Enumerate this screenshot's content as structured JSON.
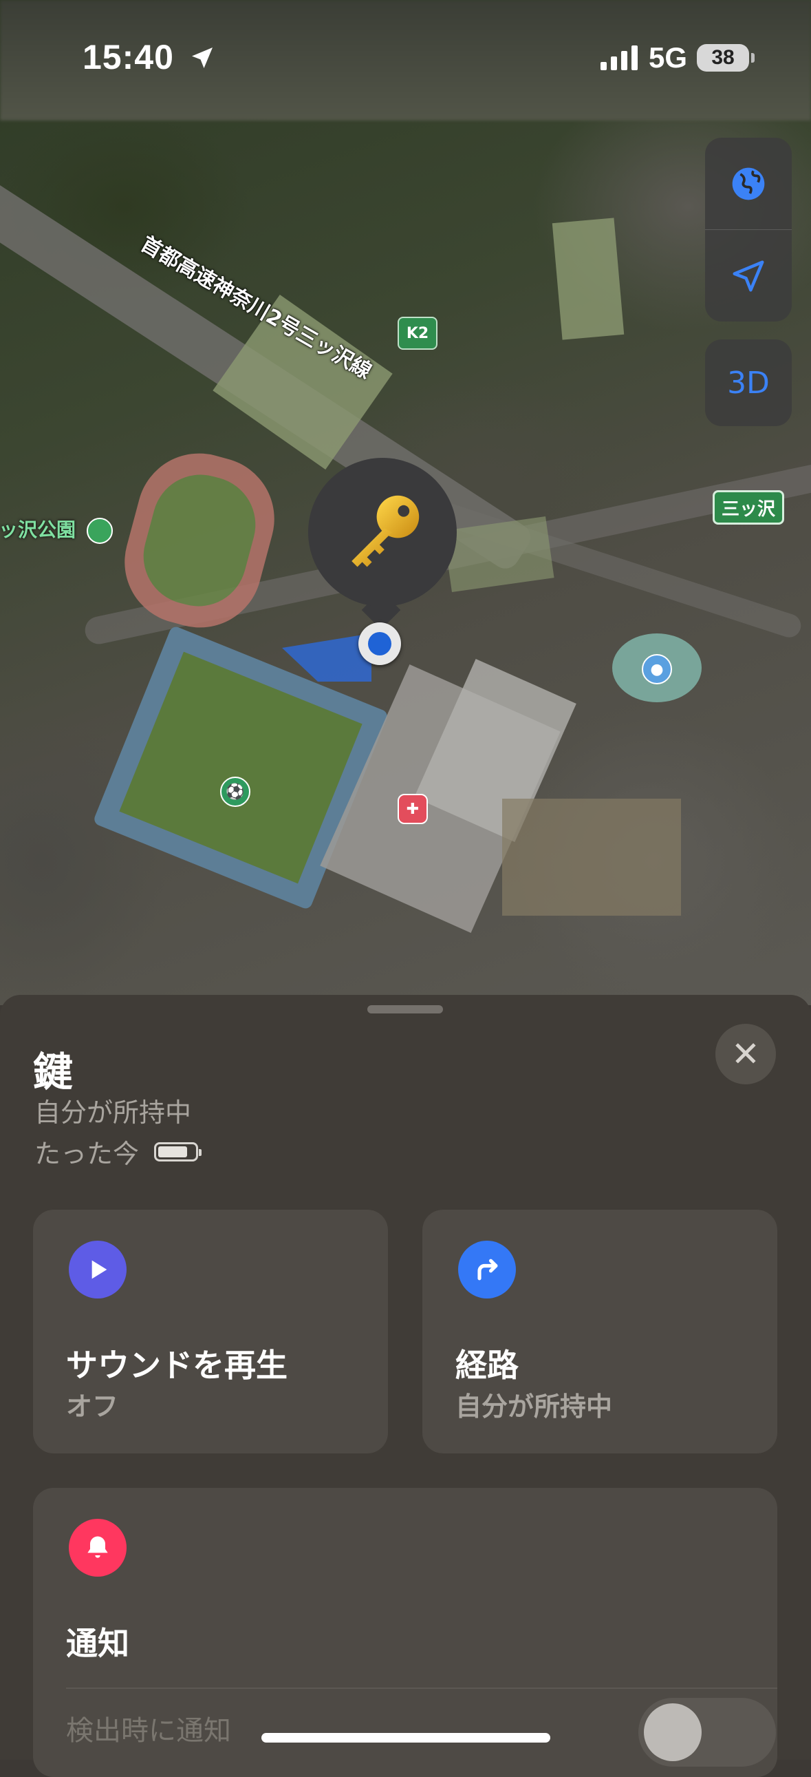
{
  "status_bar": {
    "time": "15:40",
    "network": "5G",
    "battery_level": "38"
  },
  "map": {
    "road_label": "首都高速神奈川2号三ッ沢線",
    "route_badge": "K2",
    "place_sign": "三ッ沢",
    "park_label": "ッ沢公園",
    "controls": {
      "three_d_label": "3D",
      "globe_icon": "globe-icon",
      "location_icon": "location-arrow-icon"
    }
  },
  "sheet": {
    "title": "鍵",
    "subtitle": "自分が所持中",
    "updated": "たった今",
    "close_label": "✕",
    "cards": {
      "play_sound": {
        "title": "サウンドを再生",
        "subtitle": "オフ",
        "icon": "play-icon",
        "color": "#5e5ce6"
      },
      "directions": {
        "title": "経路",
        "subtitle": "自分が所持中",
        "icon": "turn-arrow-icon",
        "color": "#3478f6"
      },
      "notifications": {
        "title": "通知",
        "row_label": "検出時に通知",
        "icon": "bell-icon",
        "color": "#ff375f"
      }
    }
  }
}
